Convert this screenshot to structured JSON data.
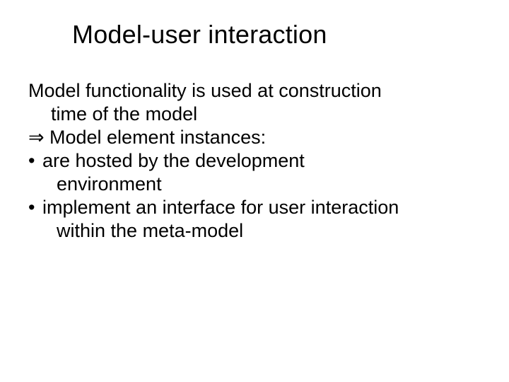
{
  "title": "Model-user interaction",
  "body": {
    "intro_line1": "Model functionality is used at construction",
    "intro_line2": "time of the model",
    "arrow_symbol": "⇒",
    "arrow_text": "Model element instances:",
    "bullet_symbol": "•",
    "bullets": [
      {
        "line1": "are hosted by the development",
        "line2": "environment"
      },
      {
        "line1": "implement an interface for user interaction",
        "line2": "within the meta-model"
      }
    ]
  }
}
